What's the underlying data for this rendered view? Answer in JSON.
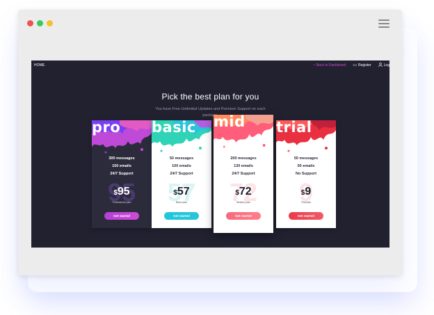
{
  "colors": {
    "window_bg": "#ececec",
    "screen_bg": "#222130",
    "accent_magenta": "#d04bd6",
    "dot_red": "#ee5252",
    "dot_green": "#3cc85c",
    "dot_yellow": "#f2c22e"
  },
  "browser": {
    "menu_icon": "hamburger-icon"
  },
  "nav": {
    "home": "HOME",
    "back_label": "Back to Dashboard",
    "back_icon": "chevron-left-icon",
    "register_label": "Register",
    "register_icon": "register-icon",
    "login_label": "Log",
    "login_icon": "user-icon"
  },
  "header": {
    "title": "Pick the best plan for you",
    "subtitle": "You have Free Unlimited Updates and Premium Support on each package."
  },
  "plans": [
    {
      "name": "pro",
      "features": [
        "300 messages",
        "150 emails",
        "24/7 Support"
      ],
      "currency": "$",
      "price": "95",
      "plan_label": "Professional plan",
      "button": "Get started",
      "button_color": "#b340d6",
      "splash_colors": [
        "#7b3ff2",
        "#c04ad8",
        "#e25ac4"
      ]
    },
    {
      "name": "basic",
      "features": [
        "50 messages",
        "100 emails",
        "24/7 Support"
      ],
      "currency": "$",
      "price": "57",
      "plan_label": "Basic plan",
      "button": "Get started",
      "button_color": "#1ec8d8",
      "splash_colors": [
        "#2fd3b5",
        "#29c4dc",
        "#b35ee0"
      ]
    },
    {
      "name": "mid",
      "features": [
        "200 messages",
        "130 emails",
        "24/7 Support"
      ],
      "currency": "$",
      "price": "72",
      "plan_label": "Medium plan",
      "button": "Get started",
      "button_color": "#f46b7d",
      "splash_colors": [
        "#ff8a5c",
        "#ff5e7a",
        "#f4a090"
      ]
    },
    {
      "name": "trial",
      "features": [
        "50 messages",
        "50 emails",
        "No Support"
      ],
      "currency": "$",
      "price": "9",
      "plan_label": "Trial plan",
      "button": "Get started",
      "button_color": "#ea3a4a",
      "splash_colors": [
        "#e83040",
        "#ff5a5a",
        "#c0203a"
      ]
    }
  ]
}
